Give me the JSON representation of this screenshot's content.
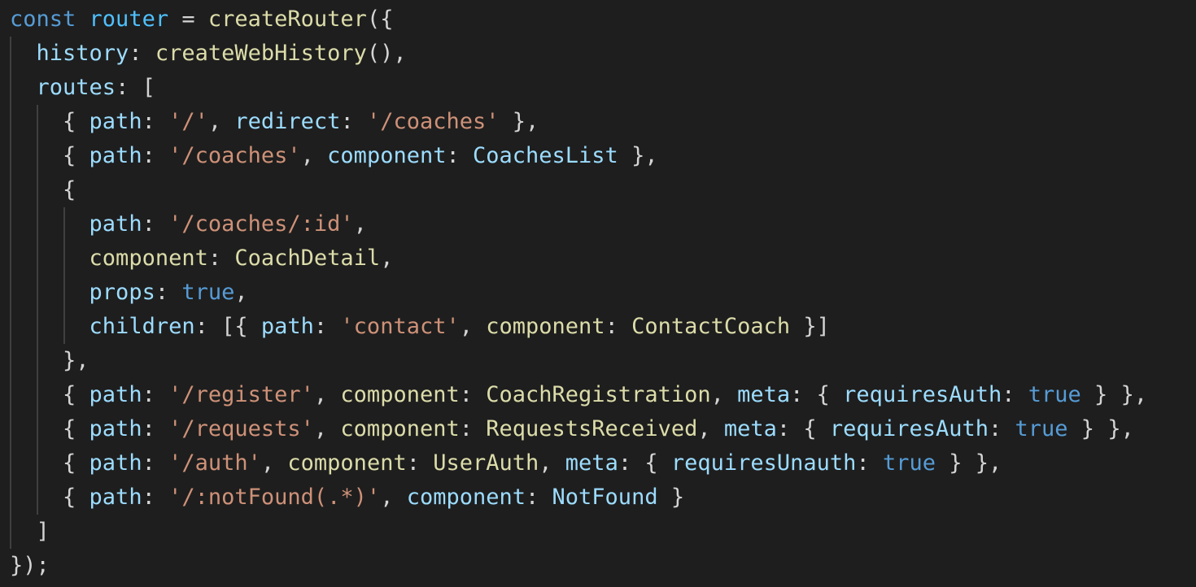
{
  "code": {
    "language": "javascript",
    "colors": {
      "background": "#1e1e1e",
      "keyword": "#569cd6",
      "variable": "#4fc1ff",
      "property": "#9cdcfe",
      "function": "#dcdcaa",
      "string": "#ce9178",
      "punctuation": "#d4d4d4",
      "indent_guide": "#404040"
    },
    "lines": [
      {
        "indent": 0,
        "tokens": [
          [
            "kw",
            "const"
          ],
          [
            "p",
            " "
          ],
          [
            "const",
            "router"
          ],
          [
            "p",
            " = "
          ],
          [
            "fn",
            "createRouter"
          ],
          [
            "p",
            "({"
          ]
        ]
      },
      {
        "indent": 1,
        "tokens": [
          [
            "prop",
            "history"
          ],
          [
            "p",
            ": "
          ],
          [
            "fn",
            "createWebHistory"
          ],
          [
            "p",
            "(),"
          ]
        ]
      },
      {
        "indent": 1,
        "tokens": [
          [
            "prop",
            "routes"
          ],
          [
            "p",
            ": ["
          ]
        ]
      },
      {
        "indent": 2,
        "tokens": [
          [
            "p",
            "{ "
          ],
          [
            "prop",
            "path"
          ],
          [
            "p",
            ": "
          ],
          [
            "str",
            "'/'"
          ],
          [
            "p",
            ", "
          ],
          [
            "prop",
            "redirect"
          ],
          [
            "p",
            ": "
          ],
          [
            "str",
            "'/coaches'"
          ],
          [
            "p",
            " },"
          ]
        ]
      },
      {
        "indent": 2,
        "tokens": [
          [
            "p",
            "{ "
          ],
          [
            "prop",
            "path"
          ],
          [
            "p",
            ": "
          ],
          [
            "str",
            "'/coaches'"
          ],
          [
            "p",
            ", "
          ],
          [
            "prop",
            "component"
          ],
          [
            "p",
            ": "
          ],
          [
            "comp",
            "CoachesList"
          ],
          [
            "p",
            " },"
          ]
        ]
      },
      {
        "indent": 2,
        "tokens": [
          [
            "p",
            "{"
          ]
        ]
      },
      {
        "indent": 3,
        "tokens": [
          [
            "prop",
            "path"
          ],
          [
            "p",
            ": "
          ],
          [
            "str",
            "'/coaches/:id'"
          ],
          [
            "p",
            ","
          ]
        ]
      },
      {
        "indent": 3,
        "tokens": [
          [
            "type",
            "component"
          ],
          [
            "p",
            ": "
          ],
          [
            "type",
            "CoachDetail"
          ],
          [
            "p",
            ","
          ]
        ]
      },
      {
        "indent": 3,
        "tokens": [
          [
            "prop",
            "props"
          ],
          [
            "p",
            ": "
          ],
          [
            "bool",
            "true"
          ],
          [
            "p",
            ","
          ]
        ]
      },
      {
        "indent": 3,
        "tokens": [
          [
            "prop",
            "children"
          ],
          [
            "p",
            ": [{ "
          ],
          [
            "prop",
            "path"
          ],
          [
            "p",
            ": "
          ],
          [
            "str",
            "'contact'"
          ],
          [
            "p",
            ", "
          ],
          [
            "type",
            "component"
          ],
          [
            "p",
            ": "
          ],
          [
            "type",
            "ContactCoach"
          ],
          [
            "p",
            " }]"
          ]
        ]
      },
      {
        "indent": 2,
        "tokens": [
          [
            "p",
            "},"
          ]
        ]
      },
      {
        "indent": 2,
        "tokens": [
          [
            "p",
            "{ "
          ],
          [
            "prop",
            "path"
          ],
          [
            "p",
            ": "
          ],
          [
            "str",
            "'/register'"
          ],
          [
            "p",
            ", "
          ],
          [
            "type",
            "component"
          ],
          [
            "p",
            ": "
          ],
          [
            "type",
            "CoachRegistration"
          ],
          [
            "p",
            ", "
          ],
          [
            "prop",
            "meta"
          ],
          [
            "p",
            ": { "
          ],
          [
            "prop",
            "requiresAuth"
          ],
          [
            "p",
            ": "
          ],
          [
            "bool",
            "true"
          ],
          [
            "p",
            " } },"
          ]
        ]
      },
      {
        "indent": 2,
        "tokens": [
          [
            "p",
            "{ "
          ],
          [
            "prop",
            "path"
          ],
          [
            "p",
            ": "
          ],
          [
            "str",
            "'/requests'"
          ],
          [
            "p",
            ", "
          ],
          [
            "type",
            "component"
          ],
          [
            "p",
            ": "
          ],
          [
            "type",
            "RequestsReceived"
          ],
          [
            "p",
            ", "
          ],
          [
            "prop",
            "meta"
          ],
          [
            "p",
            ": { "
          ],
          [
            "prop",
            "requiresAuth"
          ],
          [
            "p",
            ": "
          ],
          [
            "bool",
            "true"
          ],
          [
            "p",
            " } },"
          ]
        ]
      },
      {
        "indent": 2,
        "tokens": [
          [
            "p",
            "{ "
          ],
          [
            "prop",
            "path"
          ],
          [
            "p",
            ": "
          ],
          [
            "str",
            "'/auth'"
          ],
          [
            "p",
            ", "
          ],
          [
            "type",
            "component"
          ],
          [
            "p",
            ": "
          ],
          [
            "type",
            "UserAuth"
          ],
          [
            "p",
            ", "
          ],
          [
            "prop",
            "meta"
          ],
          [
            "p",
            ": { "
          ],
          [
            "prop",
            "requiresUnauth"
          ],
          [
            "p",
            ": "
          ],
          [
            "bool",
            "true"
          ],
          [
            "p",
            " } },"
          ]
        ]
      },
      {
        "indent": 2,
        "tokens": [
          [
            "p",
            "{ "
          ],
          [
            "prop",
            "path"
          ],
          [
            "p",
            ": "
          ],
          [
            "str",
            "'/:notFound(.*)'"
          ],
          [
            "p",
            ", "
          ],
          [
            "prop",
            "component"
          ],
          [
            "p",
            ": "
          ],
          [
            "comp",
            "NotFound"
          ],
          [
            "p",
            " }"
          ]
        ]
      },
      {
        "indent": 1,
        "tokens": [
          [
            "p",
            "]"
          ]
        ]
      },
      {
        "indent": 0,
        "tokens": [
          [
            "p",
            "});"
          ]
        ]
      }
    ]
  }
}
